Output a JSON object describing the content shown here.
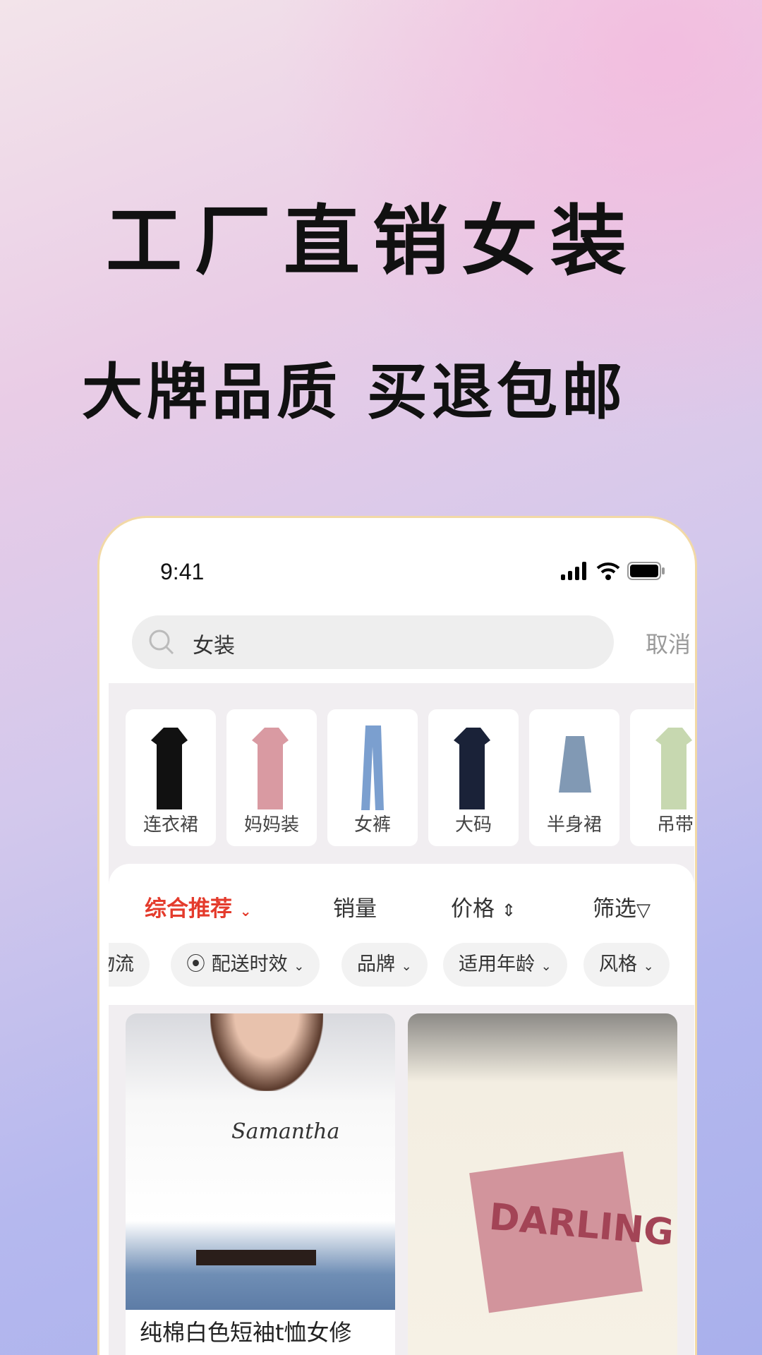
{
  "headline": "工厂直销女装",
  "subheadline": "大牌品质  买退包邮",
  "status_bar": {
    "time": "9:41"
  },
  "search": {
    "value": "女装",
    "cancel": "取消"
  },
  "categories": [
    {
      "label": "连衣裙",
      "color": "#111111"
    },
    {
      "label": "妈妈装",
      "color": "#d99aa2"
    },
    {
      "label": "女裤",
      "color": "#7b9fcf"
    },
    {
      "label": "大码",
      "color": "#1a2238"
    },
    {
      "label": "半身裙",
      "color": "#8199b4"
    },
    {
      "label": "吊带",
      "color": "#c7d8b0"
    }
  ],
  "sort": {
    "recommend": "综合推荐",
    "sales": "销量",
    "price": "价格",
    "filter": "筛选",
    "accent": "#e43b2c"
  },
  "chips": [
    "物流",
    "配送时效",
    "品牌",
    "适用年龄",
    "风格"
  ],
  "products": [
    {
      "title": "纯棉白色短袖t恤女修",
      "print": "Samantha"
    },
    {
      "title": "",
      "print": "DARLING"
    }
  ]
}
